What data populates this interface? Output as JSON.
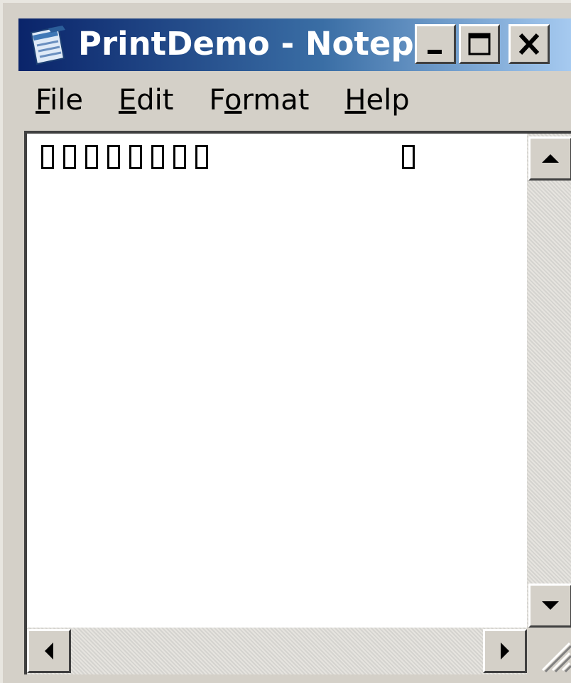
{
  "window": {
    "title": "PrintDemo - Notepad",
    "icon": "notepad-icon",
    "controls": {
      "minimize": "minimize-icon",
      "maximize": "maximize-icon",
      "close": "close-icon"
    }
  },
  "menu": {
    "items": [
      {
        "mnemonic": "F",
        "rest": "ile"
      },
      {
        "mnemonic": "E",
        "rest": "dit"
      },
      {
        "pre": "F",
        "mnemonic": "o",
        "rest": "rmat"
      },
      {
        "mnemonic": "H",
        "rest": "elp"
      }
    ]
  },
  "editor": {
    "content_line": "□□□□□□□□          □",
    "missing_glyph_run_count": 8,
    "missing_glyph_trailing_count": 1
  },
  "scrollbars": {
    "vertical": {
      "up": "scroll-up-arrow-icon",
      "down": "scroll-down-arrow-icon"
    },
    "horizontal": {
      "left": "scroll-left-arrow-icon",
      "right": "scroll-right-arrow-icon"
    }
  },
  "colors": {
    "titlebar_start": "#0a246a",
    "titlebar_end": "#a6caf0",
    "chrome": "#d4d0c8"
  }
}
